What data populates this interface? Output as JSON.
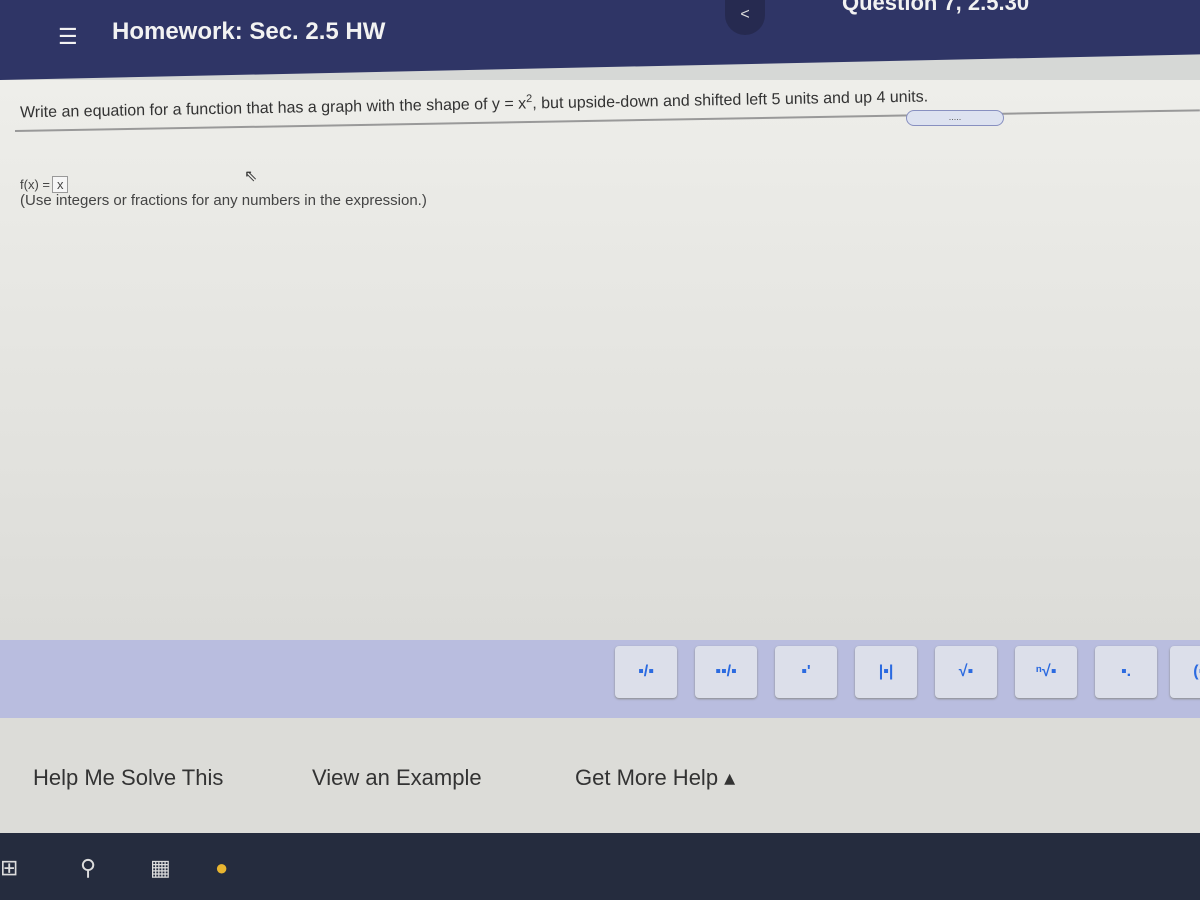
{
  "header": {
    "menu_icon": "hamburger-icon",
    "title": "Homework: Sec. 2.5 HW",
    "back": "<",
    "question": "Question 7, 2.5.30"
  },
  "question": {
    "prompt_before": "Write an equation for a function that has a graph with the shape of y = x",
    "exponent": "2",
    "prompt_after": ", but upside-down and shifted left 5 units and up 4 units.",
    "more_button": ".....",
    "answer_label": "f(x) =",
    "answer_value": "x",
    "hint": "(Use integers or fractions for any numbers in the expression.)"
  },
  "toolbar": {
    "buttons": [
      {
        "icon": "fraction-icon",
        "label": "▪/▪"
      },
      {
        "icon": "mixed-number-icon",
        "label": "▪▪/▪"
      },
      {
        "icon": "exponent-icon",
        "label": "▪'"
      },
      {
        "icon": "absolute-value-icon",
        "label": "|▪|"
      },
      {
        "icon": "square-root-icon",
        "label": "√▪"
      },
      {
        "icon": "nth-root-icon",
        "label": "ⁿ√▪"
      },
      {
        "icon": "decimal-icon",
        "label": "▪."
      },
      {
        "icon": "ordered-pair-icon",
        "label": "(▪,"
      }
    ]
  },
  "footer": {
    "help": "Help Me Solve This",
    "example": "View an Example",
    "more_help": "Get More Help ▴"
  },
  "taskbar": {
    "icons": [
      "windows-start-icon",
      "search-icon",
      "task-view-icon",
      "chrome-icon"
    ]
  }
}
